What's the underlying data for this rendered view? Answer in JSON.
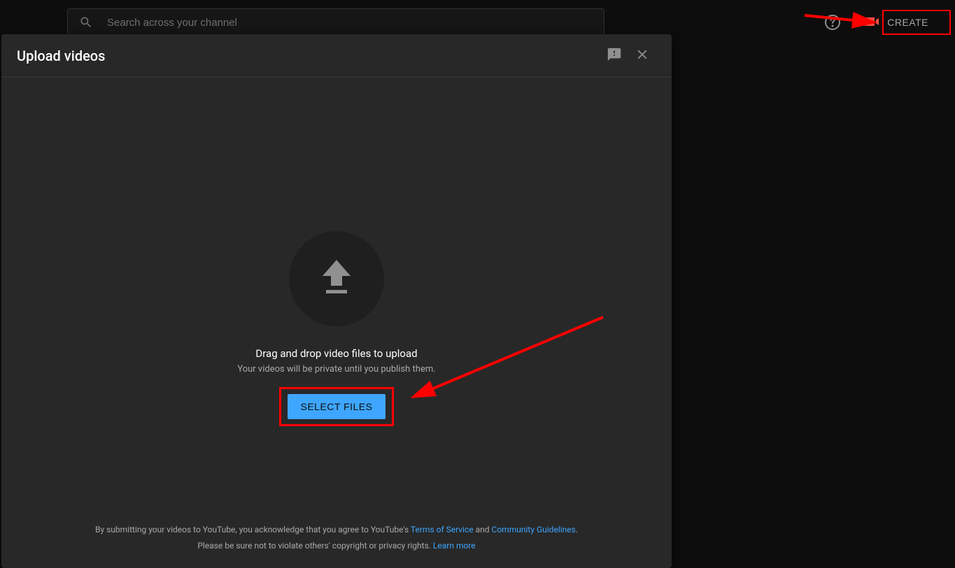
{
  "topbar": {
    "search_placeholder": "Search across your channel",
    "create_label": "CREATE"
  },
  "dialog": {
    "title": "Upload videos",
    "drag_title": "Drag and drop video files to upload",
    "drag_subtitle": "Your videos will be private until you publish them.",
    "select_files_label": "SELECT FILES"
  },
  "footer": {
    "prefix": "By submitting your videos to YouTube, you acknowledge that you agree to YouTube's ",
    "terms_link": "Terms of Service",
    "and": " and ",
    "community_link": "Community Guidelines",
    "period": ".",
    "line2": "Please be sure not to violate others' copyright or privacy rights. ",
    "learn_more_link": "Learn more"
  },
  "icons": {
    "search": "search-icon",
    "help": "help-icon",
    "create_camera": "camera-plus-icon",
    "feedback": "feedback-icon",
    "close": "close-icon",
    "upload_arrow": "upload-arrow-icon"
  },
  "colors": {
    "dialog_bg": "#282828",
    "accent_blue": "#3ea6ff",
    "highlight_red": "#ff0000",
    "text_muted": "#aaa"
  }
}
